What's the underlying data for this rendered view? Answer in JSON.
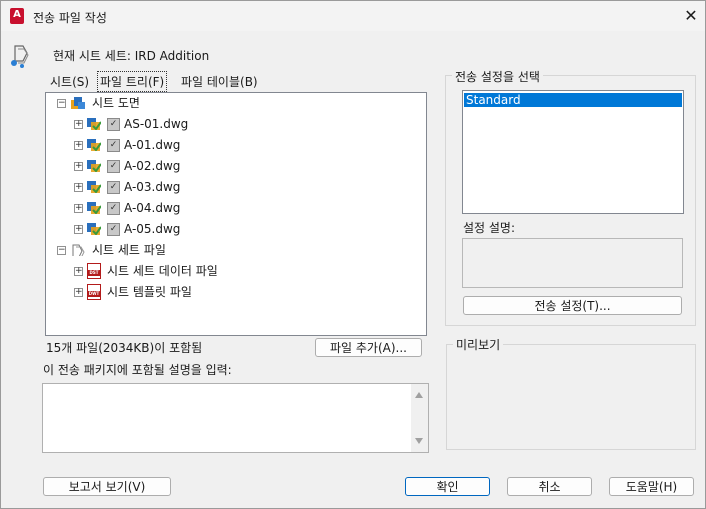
{
  "window": {
    "title": "전송 파일 작성",
    "close_glyph": "✕",
    "app_icon_letter": "A"
  },
  "header": {
    "current_sheet_set": "현재 시트 세트: IRD Addition"
  },
  "tabs": [
    {
      "label": "시트(S)",
      "active": false
    },
    {
      "label": "파일 트리(F)",
      "active": true
    },
    {
      "label": "파일 테이블(B)",
      "active": false
    }
  ],
  "tree": {
    "root_sheets": {
      "label": "시트 도면",
      "expander": "−"
    },
    "drawings": [
      {
        "label": "AS-01.dwg",
        "checked": true
      },
      {
        "label": "A-01.dwg",
        "checked": true
      },
      {
        "label": "A-02.dwg",
        "checked": true
      },
      {
        "label": "A-03.dwg",
        "checked": true
      },
      {
        "label": "A-04.dwg",
        "checked": true
      },
      {
        "label": "A-05.dwg",
        "checked": true
      }
    ],
    "root_sheetset_files": {
      "label": "시트 세트 파일",
      "expander": "−"
    },
    "sheetset_files": [
      {
        "label": "시트 세트 데이터 파일",
        "badge": "DST"
      },
      {
        "label": "시트 템플릿 파일",
        "badge": "DWT"
      }
    ],
    "expander_plus": "+",
    "check_glyph": "✓"
  },
  "files_status": "15개 파일(2034KB)이 포함됨",
  "add_file_button": "파일 추가(A)...",
  "description_prompt": "이 전송 패키지에 포함될 설명을 입력:",
  "transmittal": {
    "group_title": "전송 설정을 선택",
    "options": [
      "Standard"
    ],
    "selected": "Standard",
    "description_label": "설정 설명:",
    "settings_button": "전송 설정(T)..."
  },
  "preview": {
    "group_title": "미리보기"
  },
  "footer": {
    "view_report": "보고서 보기(V)",
    "ok": "확인",
    "cancel": "취소",
    "help": "도움말(H)"
  },
  "colors": {
    "selection": "#0078d7",
    "app_icon": "#c8102e",
    "file_icon": "#b31b1b"
  }
}
